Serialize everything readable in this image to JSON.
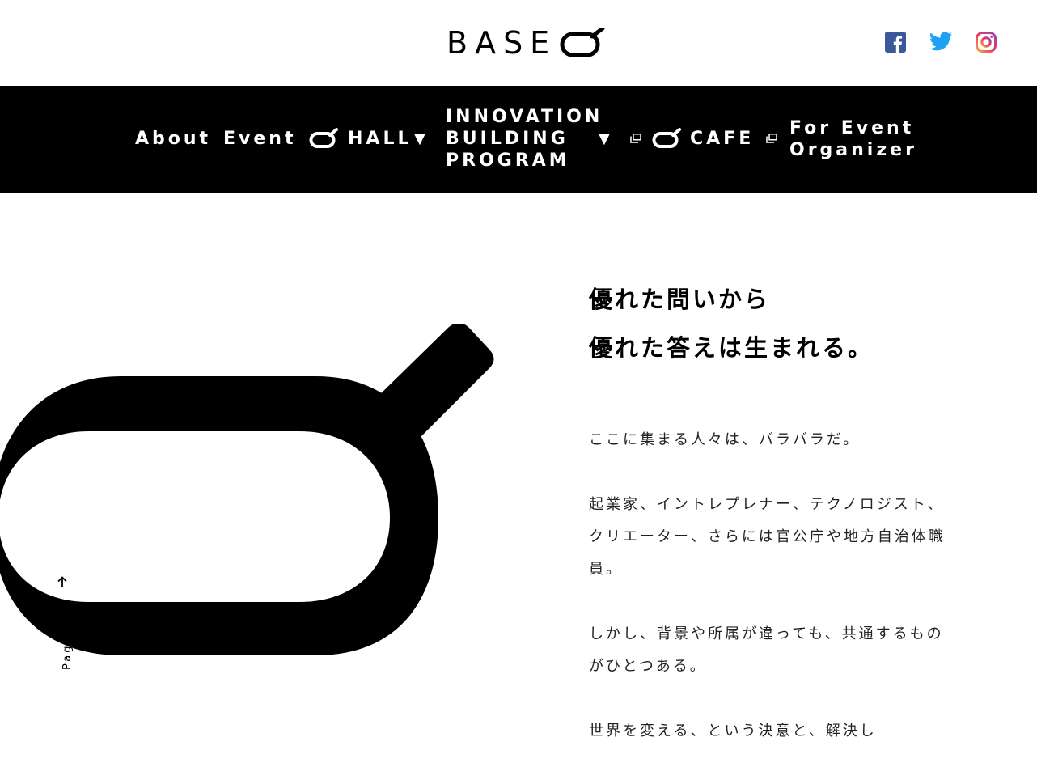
{
  "header": {
    "logo_text": "BASE",
    "social": [
      "facebook-icon",
      "twitter-icon",
      "instagram-icon"
    ]
  },
  "nav": {
    "about": "About",
    "event": "Event",
    "hall": "HALL",
    "program_line1": "INNOVATION",
    "program_line2": "BUILDING",
    "program_line3": "PROGRAM",
    "cafe": "CAFE",
    "organizer_line1": "For Event",
    "organizer_line2": "Organizer",
    "dropdown_glyph": "▼"
  },
  "pagetop": {
    "label": "Pagetop"
  },
  "intro": {
    "headline_line1": "優れた問いから",
    "headline_line2": "優れた答えは生まれる。",
    "p1": "ここに集まる人々は、バラバラだ。",
    "p2_line1": "起業家、イントレプレナー、テクノロジスト、",
    "p2_line2": "クリエーター、さらには官公庁や地方自治体職",
    "p2_line3": "員。",
    "p3_line1": "しかし、背景や所属が違っても、共通するもの",
    "p3_line2": "がひとつある。",
    "p4_line1": "世界を変える、という決意と、解決し"
  },
  "colors": {
    "nav_bg": "#000000",
    "facebook": "#3b5998",
    "twitter": "#1da1f2"
  }
}
